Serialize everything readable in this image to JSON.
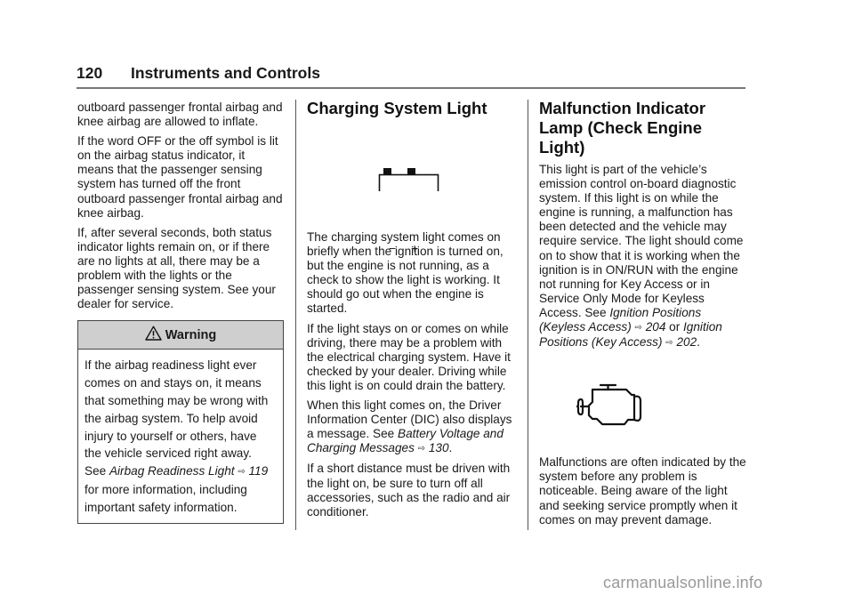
{
  "header": {
    "page_number": "120",
    "section_title": "Instruments and Controls"
  },
  "column1": {
    "paragraphs": [
      "outboard passenger frontal airbag and knee airbag are allowed to inflate.",
      "If the word OFF or the off symbol is lit on the airbag status indicator, it means that the passenger sensing system has turned off the front outboard passenger frontal airbag and knee airbag.",
      "If, after several seconds, both status indicator lights remain on, or if there are no lights at all, there may be a problem with the lights or the passenger sensing system. See your dealer for service."
    ],
    "warning": {
      "icon": "warning-triangle-icon",
      "title": "Warning",
      "text_before": "If the airbag readiness light ever comes on and stays on, it means that something may be wrong with the airbag system. To help avoid injury to yourself or others, have the vehicle serviced right away. See ",
      "xref_title": "Airbag Readiness Light",
      "xref_arrow": "⇨",
      "xref_page": "119",
      "text_after": " for more information, including important safety information."
    }
  },
  "column2": {
    "heading": "Charging System Light",
    "icon": "battery-icon",
    "battery_minus": "−",
    "battery_plus": "+",
    "paragraphs": [
      "The charging system light comes on briefly when the ignition is turned on, but the engine is not running, as a check to show the light is working. It should go out when the engine is started.",
      "If the light stays on or comes on while driving, there may be a problem with the electrical charging system. Have it checked by your dealer. Driving while this light is on could drain the battery."
    ],
    "p3": {
      "text_before": "When this light comes on, the Driver Information Center (DIC) also displays a message. See ",
      "xref_title": "Battery Voltage and Charging Messages",
      "xref_arrow": "⇨",
      "xref_page": "130",
      "text_after": "."
    },
    "p4": "If a short distance must be driven with the light on, be sure to turn off all accessories, such as the radio and air conditioner."
  },
  "column3": {
    "heading": "Malfunction Indicator Lamp (Check Engine Light)",
    "p1": {
      "text_before": "This light is part of the vehicle’s emission control on-board diagnostic system. If this light is on while the engine is running, a malfunction has been detected and the vehicle may require service. The light should come on to show that it is working when the ignition is in ON/RUN with the engine not running for Key Access or in Service Only Mode for Keyless Access. See ",
      "xref1_title": "Ignition Positions (Keyless Access)",
      "xref1_arrow": "⇨",
      "xref1_page": "204",
      "middle": " or ",
      "xref2_title": "Ignition Positions (Key Access)",
      "xref2_arrow": "⇨",
      "xref2_page": "202",
      "text_after": "."
    },
    "icon": "check-engine-icon",
    "p2": "Malfunctions are often indicated by the system before any problem is noticeable. Being aware of the light and seeking service promptly when it comes on may prevent damage."
  },
  "watermark": "carmanualsonline.info"
}
